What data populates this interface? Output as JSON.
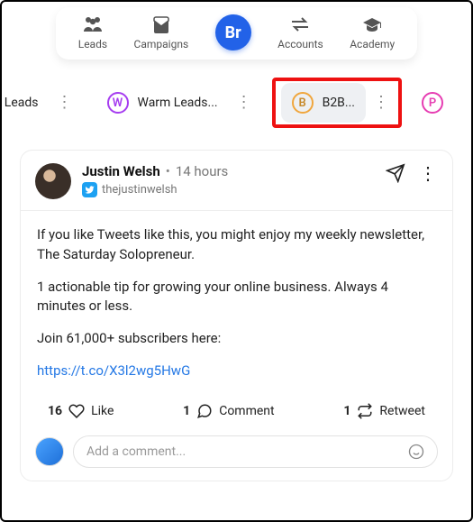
{
  "nav": {
    "leads": "Leads",
    "campaigns": "Campaigns",
    "center": "Br",
    "accounts": "Accounts",
    "academy": "Academy"
  },
  "tabs": {
    "t0": {
      "label": "ed Leads"
    },
    "t1": {
      "badge": "W",
      "label": "Warm Leads..."
    },
    "t2": {
      "badge": "B",
      "label": "B2B..."
    },
    "t3": {
      "badge": "P"
    }
  },
  "post": {
    "author_name": "Justin Welsh",
    "time": "14 hours",
    "handle": "thejustinwelsh",
    "p1": "If you like Tweets like this, you might enjoy my weekly newsletter, The Saturday Solopreneur.",
    "p2": "1 actionable tip for growing your online business. Always 4 minutes or less.",
    "p3": "Join 61,000+ subscribers here:",
    "link": "https://t.co/X3l2wg5HwG",
    "likes": "16",
    "like_label": "Like",
    "comments": "1",
    "comment_label": "Comment",
    "retweets": "1",
    "retweet_label": "Retweet",
    "comment_placeholder": "Add a comment..."
  }
}
